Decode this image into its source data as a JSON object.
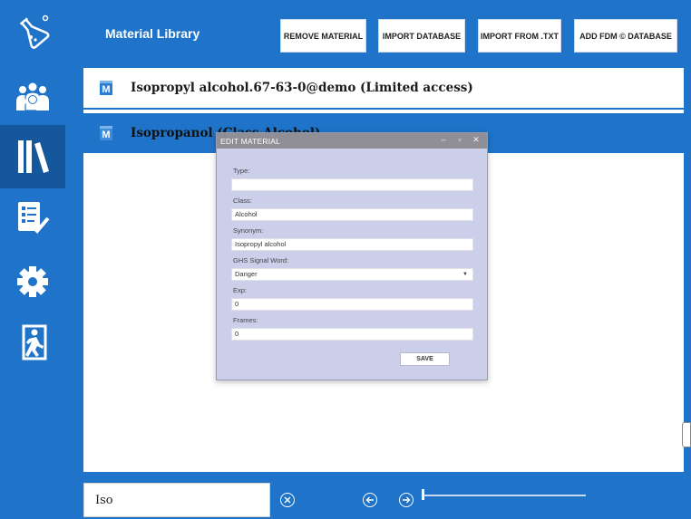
{
  "sidebar": {
    "items": [
      {
        "name": "flask-icon"
      },
      {
        "name": "users-icon"
      },
      {
        "name": "library-icon"
      },
      {
        "name": "checklist-icon"
      },
      {
        "name": "gear-icon"
      },
      {
        "name": "exit-icon"
      }
    ],
    "active_index": 2
  },
  "header": {
    "title": "Material Library",
    "buttons": {
      "remove": "REMOVE MATERIAL",
      "import_db": "IMPORT DATABASE",
      "import_txt": "IMPORT FROM .TXT",
      "add_fdm": "ADD FDM © DATABASE"
    }
  },
  "materials": [
    {
      "icon_letter": "M",
      "label": "Isopropyl alcohol.67-63-0@demo (Limited access)",
      "selected": false
    },
    {
      "icon_letter": "M",
      "label": "Isopropanol (Class Alcohol)",
      "selected": true
    }
  ],
  "dialog": {
    "title": "EDIT MATERIAL",
    "controls": {
      "minimize": "–",
      "maximize": "▫",
      "close": "✕"
    },
    "fields": {
      "type": {
        "label": "Type:",
        "value": ""
      },
      "class": {
        "label": "Class:",
        "value": "Alcohol"
      },
      "synonym": {
        "label": "Synonym:",
        "value": "Isopropyl alcohol"
      },
      "ghs": {
        "label": "GHS Signal Word:",
        "value": "Danger"
      },
      "exp": {
        "label": "Exp:",
        "value": "0"
      },
      "frames": {
        "label": "Frames:",
        "value": "0"
      }
    },
    "save_label": "SAVE"
  },
  "footer": {
    "search_value": "Iso",
    "slider_position": 0
  },
  "colors": {
    "primary": "#1f74c9",
    "active_nav": "#15579c",
    "dialog_bg": "#cccfea",
    "dialog_titlebar": "#8f8f95"
  }
}
